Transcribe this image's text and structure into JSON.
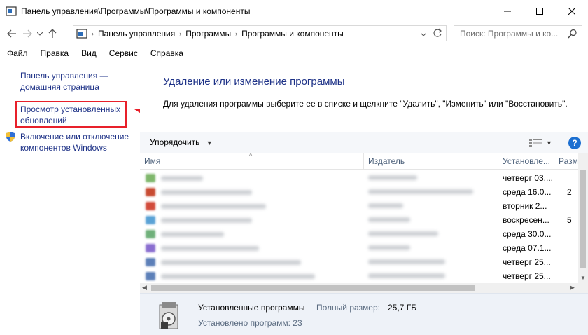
{
  "window": {
    "title": "Панель управления\\Программы\\Программы и компоненты"
  },
  "address": {
    "breadcrumbs": [
      "Панель управления",
      "Программы",
      "Программы и компоненты"
    ],
    "search_placeholder": "Поиск: Программы и ко..."
  },
  "menu": [
    "Файл",
    "Правка",
    "Вид",
    "Сервис",
    "Справка"
  ],
  "sidebar": {
    "home_link": "Панель управления — домашняя страница",
    "updates_link": "Просмотр установленных обновлений",
    "features_link": "Включение или отключение компонентов Windows"
  },
  "main": {
    "heading": "Удаление или изменение программы",
    "description": "Для удаления программы выберите ее в списке и щелкните \"Удалить\", \"Изменить\" или \"Восстановить\".",
    "organize_label": "Упорядочить",
    "help_label": "?",
    "columns": [
      "Имя",
      "Издатель",
      "Установле...",
      "Разм"
    ],
    "rows": [
      {
        "date": "четверг 03....",
        "size": "",
        "icon_color": "#7fb76c"
      },
      {
        "date": "среда 16.0...",
        "size": "2",
        "icon_color": "#c84b32"
      },
      {
        "date": "вторник 2...",
        "size": "",
        "icon_color": "#d24a3a"
      },
      {
        "date": "воскресен...",
        "size": "5",
        "icon_color": "#5aa2d6"
      },
      {
        "date": "среда 30.0...",
        "size": "",
        "icon_color": "#6fb07a"
      },
      {
        "date": "среда 07.1...",
        "size": "",
        "icon_color": "#8a6ed0"
      },
      {
        "date": "четверг 25...",
        "size": "",
        "icon_color": "#5c7fb8"
      },
      {
        "date": "четверг 25...",
        "size": "",
        "icon_color": "#5c7fb8"
      }
    ]
  },
  "details": {
    "title": "Установленные программы",
    "size_label": "Полный размер:",
    "size_value": "25,7 ГБ",
    "count": "Установлено программ: 23"
  },
  "colors": {
    "link": "#1e3287",
    "highlight": "#e8202a",
    "details_bg": "#eef2f8"
  }
}
